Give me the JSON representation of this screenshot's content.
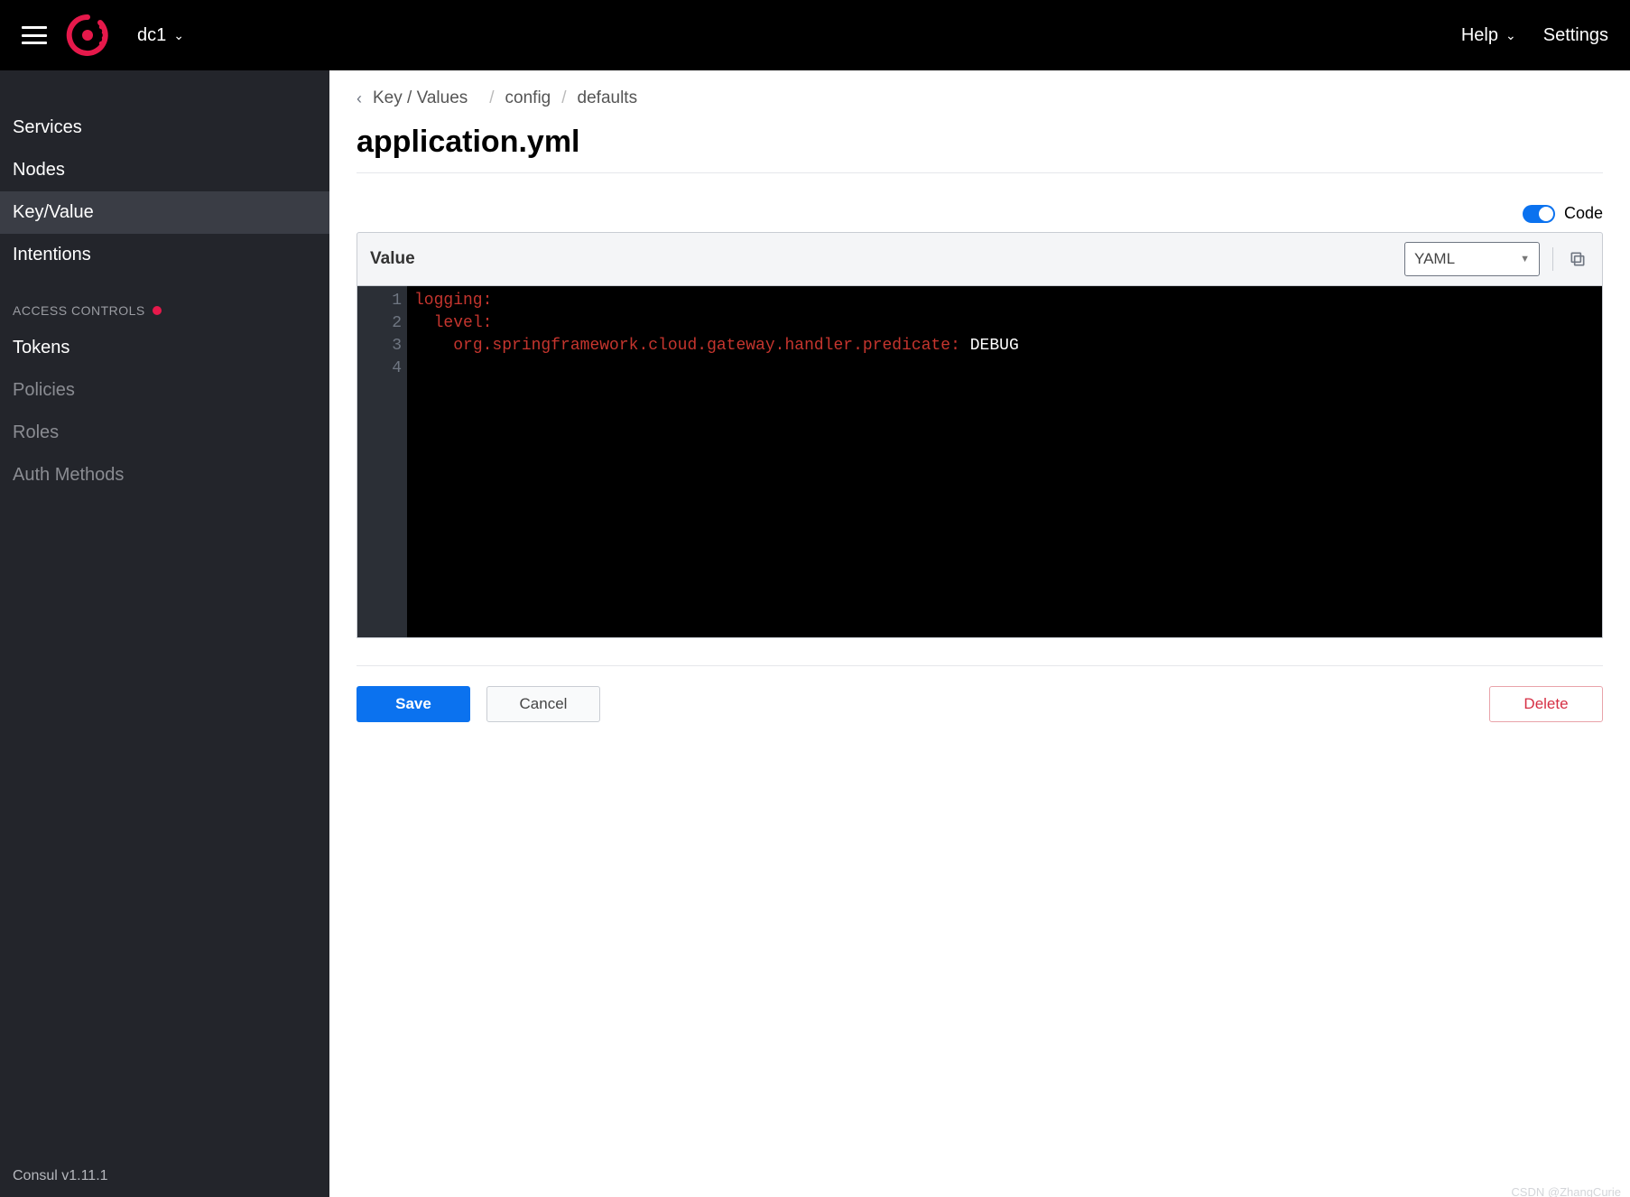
{
  "topbar": {
    "datacenter": "dc1",
    "help": "Help",
    "settings": "Settings"
  },
  "sidebar": {
    "items": [
      {
        "label": "Services",
        "active": false
      },
      {
        "label": "Nodes",
        "active": false
      },
      {
        "label": "Key/Value",
        "active": true
      },
      {
        "label": "Intentions",
        "active": false
      }
    ],
    "access_header": "ACCESS CONTROLS",
    "access_items": [
      {
        "label": "Tokens",
        "muted": false
      },
      {
        "label": "Policies",
        "muted": true
      },
      {
        "label": "Roles",
        "muted": true
      },
      {
        "label": "Auth Methods",
        "muted": true
      }
    ],
    "footer": "Consul v1.11.1"
  },
  "breadcrumb": {
    "root": "Key / Values",
    "segments": [
      "config",
      "defaults"
    ]
  },
  "page": {
    "title": "application.yml",
    "code_toggle_label": "Code",
    "value_label": "Value",
    "language": "YAML",
    "code_lines": [
      {
        "indent": 0,
        "key": "logging",
        "value": null
      },
      {
        "indent": 1,
        "key": "level",
        "value": null
      },
      {
        "indent": 2,
        "key": "org.springframework.cloud.gateway.handler.predicate",
        "value": "DEBUG"
      },
      {
        "indent": 0,
        "key": null,
        "value": null
      }
    ],
    "save": "Save",
    "cancel": "Cancel",
    "delete": "Delete"
  },
  "watermark": "CSDN @ZhangCurie"
}
